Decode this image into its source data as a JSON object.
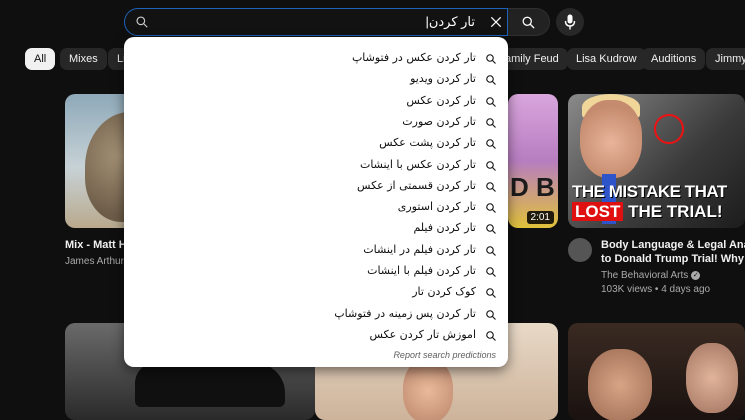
{
  "search": {
    "query": "تار کردن|",
    "clear_icon": "close-icon",
    "search_icon": "search-icon",
    "mic_icon": "mic-icon"
  },
  "chips": [
    "All",
    "Mixes",
    "Li",
    "amily Feud",
    "Lisa Kudrow",
    "Auditions",
    "Jimmy"
  ],
  "suggestions": [
    "تار کردن عکس در فتوشاپ",
    "تار کردن ویدیو",
    "تار کردن عکس",
    "تار کردن صورت",
    "تار کردن پشت عکس",
    "تار کردن عکس با اینشات",
    "تار کردن قسمتی از عکس",
    "تار کردن استوری",
    "تار کردن فیلم",
    "تار کردن فیلم در اینشات",
    "تار کردن فیلم با اینشات",
    "کوک کردن تار",
    "تار کردن پس زمینه در فتوشاپ",
    "اموزش تار کردن عکس"
  ],
  "report_text": "Report search predictions",
  "videos": {
    "v1": {
      "title": "Mix - Matt H",
      "channel": "James Arthur, M"
    },
    "v2": {
      "thumb_text": "D B",
      "duration": "2:01"
    },
    "v3": {
      "title_line1": "Body Language & Legal Analys",
      "title_line2": "to Donald Trump Trial! Why dic",
      "channel": "The Behavioral Arts",
      "meta": "103K views • 4 days ago",
      "thumb_line1": "THE MISTAKE THAT",
      "thumb_red": "LOST",
      "thumb_line2_rest": " THE TRIAL!"
    }
  }
}
